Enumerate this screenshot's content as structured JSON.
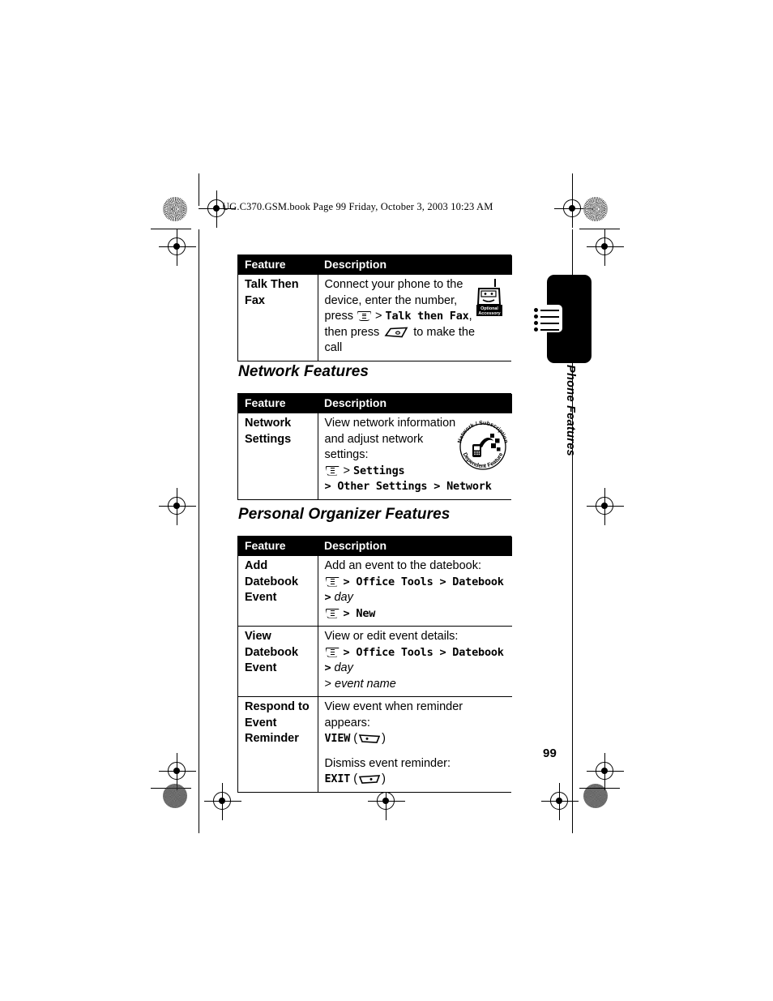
{
  "page": {
    "header_line": "UG.C370.GSM.book  Page 99  Friday, October 3, 2003  10:23 AM",
    "number": "99",
    "side_tab_label": "Phone Features"
  },
  "icons": {
    "menu_key": "menu-key-icon",
    "send_key": "send-key-icon",
    "left_soft_key": "left-soft-key-icon",
    "right_soft_key": "right-soft-key-icon",
    "optional_accessory_badge": "optional-accessory-badge-icon",
    "network_dependent_badge": "network-subscription-dependent-feature-badge-icon",
    "registration_mark": "registration-crosshair-icon",
    "halftone_mark": "halftone-density-circle-icon"
  },
  "badges": {
    "optional_accessory": {
      "line1": "Optional",
      "line2": "Accessory"
    },
    "network_dependent": {
      "top_arc": "Network / Subscription",
      "bottom_arc": "Dependent  Feature"
    }
  },
  "tables": {
    "headers": {
      "feature": "Feature",
      "description": "Description"
    },
    "talk_then_fax": {
      "rows": [
        {
          "feature": "Talk Then Fax",
          "desc_lines": [
            {
              "type": "text",
              "text": "Connect your phone to the"
            },
            {
              "type": "text",
              "text": "device, enter the number,"
            },
            {
              "type": "mixed",
              "pre": "press ",
              "key": "menu",
              "mid": " > ",
              "mono": "Talk then Fax",
              "post": ","
            },
            {
              "type": "mixed2",
              "pre": "then press ",
              "key": "send",
              "post": " to make the"
            },
            {
              "type": "text",
              "text": "call"
            }
          ],
          "badge": "optional_accessory"
        }
      ]
    },
    "network_features": {
      "title": "Network Features",
      "rows": [
        {
          "feature": "Network Settings",
          "desc_lines": [
            {
              "type": "text",
              "text": "View network information"
            },
            {
              "type": "text",
              "text": "and adjust network"
            },
            {
              "type": "text",
              "text": "settings:"
            },
            {
              "type": "mixed",
              "pre": "",
              "key": "menu",
              "mid": " > ",
              "mono": "Settings",
              "post": ""
            },
            {
              "type": "mono_path",
              "text": "> Other Settings > Network"
            }
          ],
          "badge": "network_dependent"
        }
      ]
    },
    "personal_organizer_features": {
      "title": "Personal Organizer Features",
      "rows": [
        {
          "feature": "Add Datebook Event",
          "desc_lines": [
            {
              "type": "text",
              "text": "Add an event to the datebook:"
            },
            {
              "type": "path_day",
              "key": "menu",
              "mono": "> Office Tools > Datebook >",
              "italic": "day"
            },
            {
              "type": "path_new",
              "key": "menu",
              "mono": "> New"
            }
          ]
        },
        {
          "feature": "View Datebook Event",
          "desc_lines": [
            {
              "type": "text",
              "text": "View or edit event details:"
            },
            {
              "type": "path_day",
              "key": "menu",
              "mono": "> Office Tools > Datebook >",
              "italic": "day"
            },
            {
              "type": "italic_cont",
              "gt": "> ",
              "italic": "event name"
            }
          ]
        },
        {
          "feature": "Respond to Event Reminder",
          "desc_lines": [
            {
              "type": "text",
              "text": "View event when reminder appears:"
            },
            {
              "type": "softkey",
              "label": "VIEW",
              "key": "left_soft"
            },
            {
              "type": "spacer"
            },
            {
              "type": "text",
              "text": "Dismiss event reminder:"
            },
            {
              "type": "softkey",
              "label": "EXIT",
              "key": "right_soft"
            }
          ]
        }
      ]
    }
  }
}
